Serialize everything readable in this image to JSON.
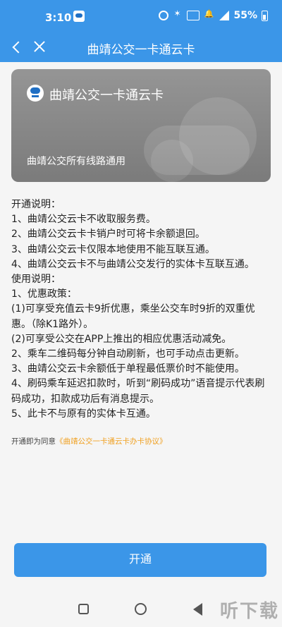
{
  "status_bar": {
    "time": "3:10",
    "battery": "55%"
  },
  "nav": {
    "title": "曲靖公交一卡通云卡"
  },
  "card": {
    "title": "曲靖公交一卡通云卡",
    "subtitle": "曲靖公交所有线路通用"
  },
  "description": {
    "lines": [
      "开通说明：",
      "1、曲靖公交云卡不收取服务费。",
      "2、曲靖公交云卡卡销户时可将卡余额退回。",
      "3、曲靖公交云卡仅限本地使用不能互联互通。",
      "4、曲靖公交云卡不与曲靖公交发行的实体卡互联互通。",
      "使用说明：",
      "1、优惠政策：",
      "(1)可享受充值云卡9折优惠，乘坐公交车时9折的双重优惠。（除K1路外）。",
      "(2)可享受公交在APP上推出的相应优惠活动减免。",
      "2、乘车二维码每分钟自动刷新，也可手动点击更新。",
      "3、曲靖公交云卡余额低于单程最低票价时不能使用。",
      "4、刷码乘车延迟扣款时，听到“刷码成功”语音提示代表刷码成功，扣款成功后有消息提示。",
      "5、此卡不与原有的实体卡互通。"
    ]
  },
  "agreement": {
    "prefix": "开通即为同意",
    "link": "《曲靖公交一卡通云卡办卡协议》"
  },
  "button": {
    "open_label": "开通"
  },
  "watermark": "听下载"
}
